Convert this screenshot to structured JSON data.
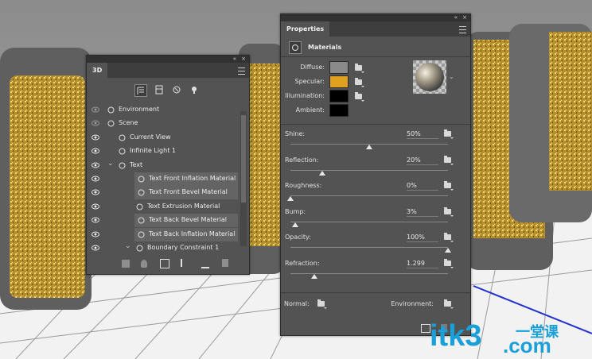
{
  "panel_3d": {
    "tab": "3D",
    "controls": "«",
    "close": "×",
    "layers": [
      {
        "label": "Environment",
        "icon": "environment-icon"
      },
      {
        "label": "Scene",
        "icon": "scene-icon"
      },
      {
        "label": "Current View",
        "icon": "camera-icon"
      },
      {
        "label": "Infinite Light 1",
        "icon": "light-icon"
      },
      {
        "label": "Text",
        "icon": "mesh-icon"
      },
      {
        "label": "Text Front Inflation Material",
        "icon": "material-icon"
      },
      {
        "label": "Text Front Bevel Material",
        "icon": "material-icon"
      },
      {
        "label": "Text Extrusion Material",
        "icon": "material-icon"
      },
      {
        "label": "Text Back Bevel Material",
        "icon": "material-icon"
      },
      {
        "label": "Text Back Inflation Material",
        "icon": "material-icon"
      },
      {
        "label": "Boundary Constraint 1",
        "icon": "constraint-icon"
      }
    ]
  },
  "panel_properties": {
    "tab": "Properties",
    "controls": "«",
    "close": "×",
    "section": "Materials",
    "diffuse_label": "Diffuse:",
    "specular_label": "Specular:",
    "illumination_label": "Illumination:",
    "ambient_label": "Ambient:",
    "colors": {
      "diffuse": "#8a8a8a",
      "specular": "#e0a020",
      "illumination": "#000000",
      "ambient": "#000000"
    },
    "sliders": [
      {
        "label": "Shine:",
        "value": "50%",
        "level": 0.5
      },
      {
        "label": "Reflection:",
        "value": "20%",
        "level": 0.2
      },
      {
        "label": "Roughness:",
        "value": "0%",
        "level": 0.0
      },
      {
        "label": "Bump:",
        "value": "3%",
        "level": 0.03
      },
      {
        "label": "Opacity:",
        "value": "100%",
        "level": 1.0
      },
      {
        "label": "Refraction:",
        "value": "1.299",
        "level": 0.15
      }
    ],
    "normal_label": "Normal:",
    "environment_label": "Environment:"
  },
  "watermark": {
    "text": "itk3",
    "dot_com": ".com",
    "cn": "一堂课"
  }
}
